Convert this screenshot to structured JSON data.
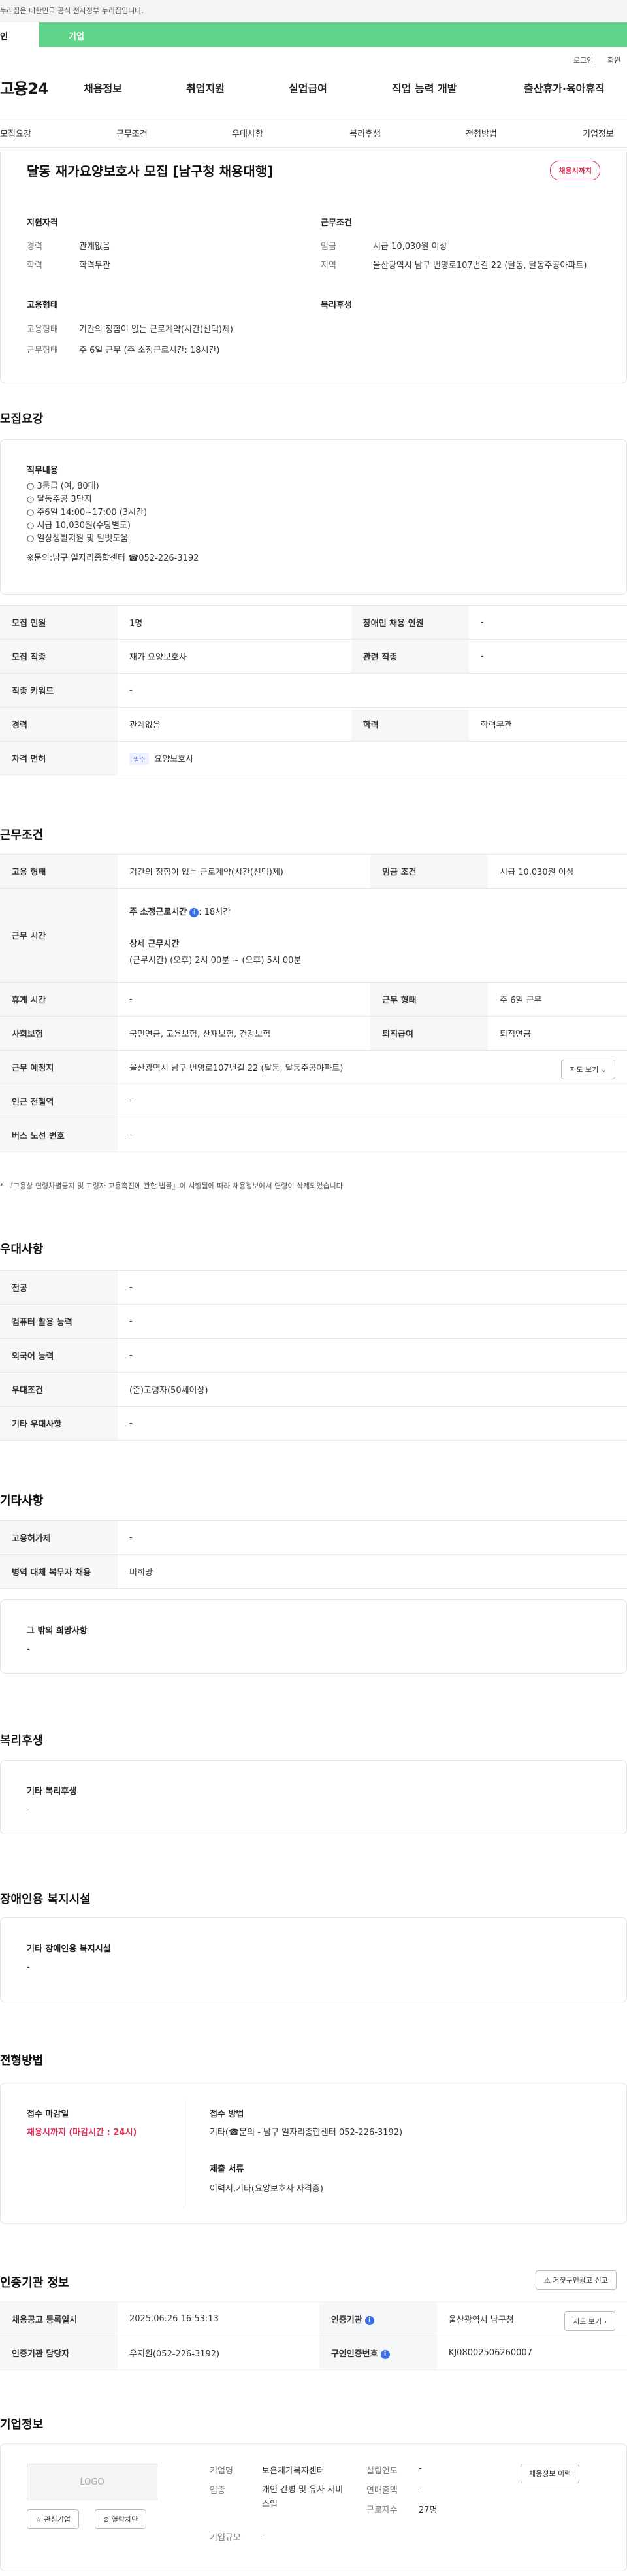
{
  "gov_notice": "누리집은 대한민국 공식 전자정부 누리집입니다.",
  "tabs": {
    "personal": "인",
    "business": "기업"
  },
  "util": {
    "login": "로그인",
    "signup": "회원"
  },
  "gnb": {
    "logo": "고용24",
    "menu": [
      "채용정보",
      "취업지원",
      "실업급여",
      "직업 능력 개발",
      "출산휴가·육아휴직"
    ]
  },
  "subnav": [
    "모집요강",
    "근무조건",
    "우대사항",
    "복리후생",
    "전형방법",
    "기업정보"
  ],
  "job": {
    "title": "달동 재가요양보호사 모집 [남구청 채용대행]",
    "badge": "채용시까지",
    "qual_title": "지원자격",
    "career_k": "경력",
    "career_v": "관계없음",
    "edu_k": "학력",
    "edu_v": "학력무관",
    "emp_title": "고용형태",
    "emptype_k": "고용형태",
    "emptype_v": "기간의 정함이 없는 근로계약(시간(선택)제)",
    "workform_k": "근무형태",
    "workform_v": "주 6일 근무 (주 소정근로시간: 18시간)",
    "cond_title": "근무조건",
    "wage_k": "임금",
    "wage_v": "시급 10,030원 이상",
    "area_k": "지역",
    "area_v": "울산광역시 남구 번영로107번길 22 (달동, 달동주공아파트)",
    "welfare_title": "복리후생"
  },
  "recruit": {
    "section": "모집요강",
    "duty_title": "직무내용",
    "duty_lines": [
      "○ 3등급 (여, 80대)",
      "○ 달동주공 3단지",
      "○ 주6일 14:00~17:00 (3시간)",
      "○ 시급 10,030원(수당별도)",
      "○ 일상생활지원 및 말벗도움",
      "",
      "※문의:남구 일자리종합센터 ☎052-226-3192"
    ],
    "rows": {
      "count_k": "모집 인원",
      "count_v": "1명",
      "disabled_k": "장애인 채용 인원",
      "disabled_v": "-",
      "job_k": "모집 직종",
      "job_v": "재가 요양보호사",
      "related_k": "관련 직종",
      "related_v": "-",
      "keyword_k": "직종 키워드",
      "keyword_v": "-",
      "career_k": "경력",
      "career_v": "관계없음",
      "edu_k": "학력",
      "edu_v": "학력무관",
      "license_k": "자격 면허",
      "license_tag": "필수",
      "license_v": "요양보호사"
    }
  },
  "work": {
    "section": "근무조건",
    "emptype_k": "고용 형태",
    "emptype_v": "기간의 정함이 없는 근로계약(시간(선택)제)",
    "wage_k": "임금 조건",
    "wage_v": "시급 10,030원 이상",
    "hours_k": "근무 시간",
    "hours_weekly_label": "주 소정근로시간",
    "hours_weekly_v": ": 18시간",
    "hours_detail_label": "상세 근무시간",
    "hours_detail_v": "(근무시간) (오후) 2시 00분 ~ (오후) 5시 00분",
    "holiday_k": "휴게 시간",
    "holiday_v": "-",
    "form_k": "근무 형태",
    "form_v": "주 6일 근무",
    "insurance_k": "사회보험",
    "insurance_v": "국민연금, 고용보험, 산재보험, 건강보험",
    "retire_k": "퇴직급여",
    "retire_v": "퇴직연금",
    "place_k": "근무 예정지",
    "place_v": "울산광역시 남구 번영로107번길 22 (달동, 달동주공아파트)",
    "map_btn": "지도 보기",
    "subway_k": "인근 전철역",
    "subway_v": "-",
    "bus_k": "버스 노선 번호",
    "bus_v": "-",
    "note": "* 『고용상 연령차별금지 및 고령자 고용촉진에 관한 법률』이 시행됨에 따라 채용정보에서 연령이 삭제되었습니다."
  },
  "pref": {
    "section": "우대사항",
    "major_k": "전공",
    "major_v": "-",
    "pc_k": "컴퓨터 활용 능력",
    "pc_v": "-",
    "lang_k": "외국어 능력",
    "lang_v": "-",
    "cond_k": "우대조건",
    "cond_v": "(준)고령자(50세이상)",
    "etc_k": "기타 우대사항",
    "etc_v": "-"
  },
  "other": {
    "section": "기타사항",
    "hire_k": "고용허가제",
    "hire_v": "-",
    "military_k": "병역 대체 복무자 채용",
    "military_v": "비희망",
    "wish_title": "그 밖의 희망사항",
    "wish_v": "-"
  },
  "welfare": {
    "section": "복리후생",
    "title": "기타 복리후생",
    "value": "-"
  },
  "disabled": {
    "section": "장애인용 복지시설",
    "title": "기타 장애인용 복지시설",
    "value": "-"
  },
  "screening": {
    "section": "전형방법",
    "deadline_title": "접수 마감일",
    "deadline_v": "채용시까지 (마감시간 : 24시)",
    "method_title": "접수 방법",
    "method_v": "기타(☎문의 - 남구 일자리종합센터 052-226-3192)",
    "docs_title": "제출 서류",
    "docs_v": "이력서,기타(요양보호사 자격증)"
  },
  "cert": {
    "section": "인증기관 정보",
    "report_btn": "거짓구인광고 신고",
    "reg_k": "채용공고 등록일시",
    "reg_v": "2025.06.26 16:53:13",
    "agency_k": "인증기관",
    "agency_v": "울산광역시 남구청",
    "map_btn": "지도 보기",
    "manager_k": "인증기관 담당자",
    "manager_v": "우지원(052-226-3192)",
    "jobno_k": "구인인증번호",
    "jobno_v": "KJ08002506260007"
  },
  "company": {
    "section": "기업정보",
    "logo": "LOGO",
    "fav_btn": "관심기업",
    "block_btn": "열람차단",
    "name_k": "기업명",
    "name_v": "보은재가복지센터",
    "industry_k": "업종",
    "industry_v": "개인 간병 및 유사 서비스업",
    "size_k": "기업규모",
    "size_v": "-",
    "year_k": "설립연도",
    "year_v": "-",
    "sales_k": "연매출액",
    "sales_v": "-",
    "staff_k": "근로자수",
    "staff_v": "27명",
    "history_btn": "채용정보 이력"
  }
}
